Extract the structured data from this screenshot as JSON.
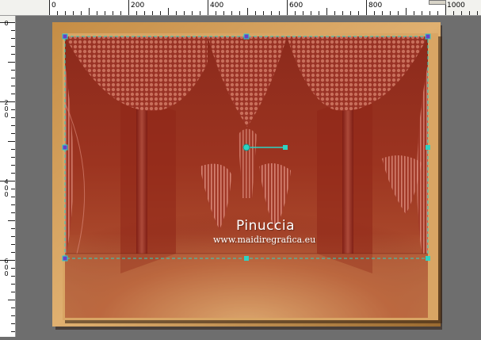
{
  "ruler": {
    "top_labels": [
      "0",
      "200",
      "400",
      "600",
      "800",
      "1000"
    ],
    "left_labels": [
      "0",
      "200",
      "400",
      "600"
    ]
  },
  "watermark": {
    "name": "Pinuccia",
    "url": "www.maidiregrafica.eu"
  },
  "colors": {
    "workspace": "#6e6e6e",
    "frame_outer": "#b07c3c",
    "frame_inner": "#d9a564",
    "deep_red": "#8a1d14",
    "curtain_light": "#d98a78",
    "floor_light": "#d9a868",
    "selection": "#2ed3c3",
    "handle_purple": "#6a3fc8"
  },
  "icons": {
    "rotation_handle": "circle-target-icon",
    "bounding_box_handle": "square-handle-icon"
  }
}
